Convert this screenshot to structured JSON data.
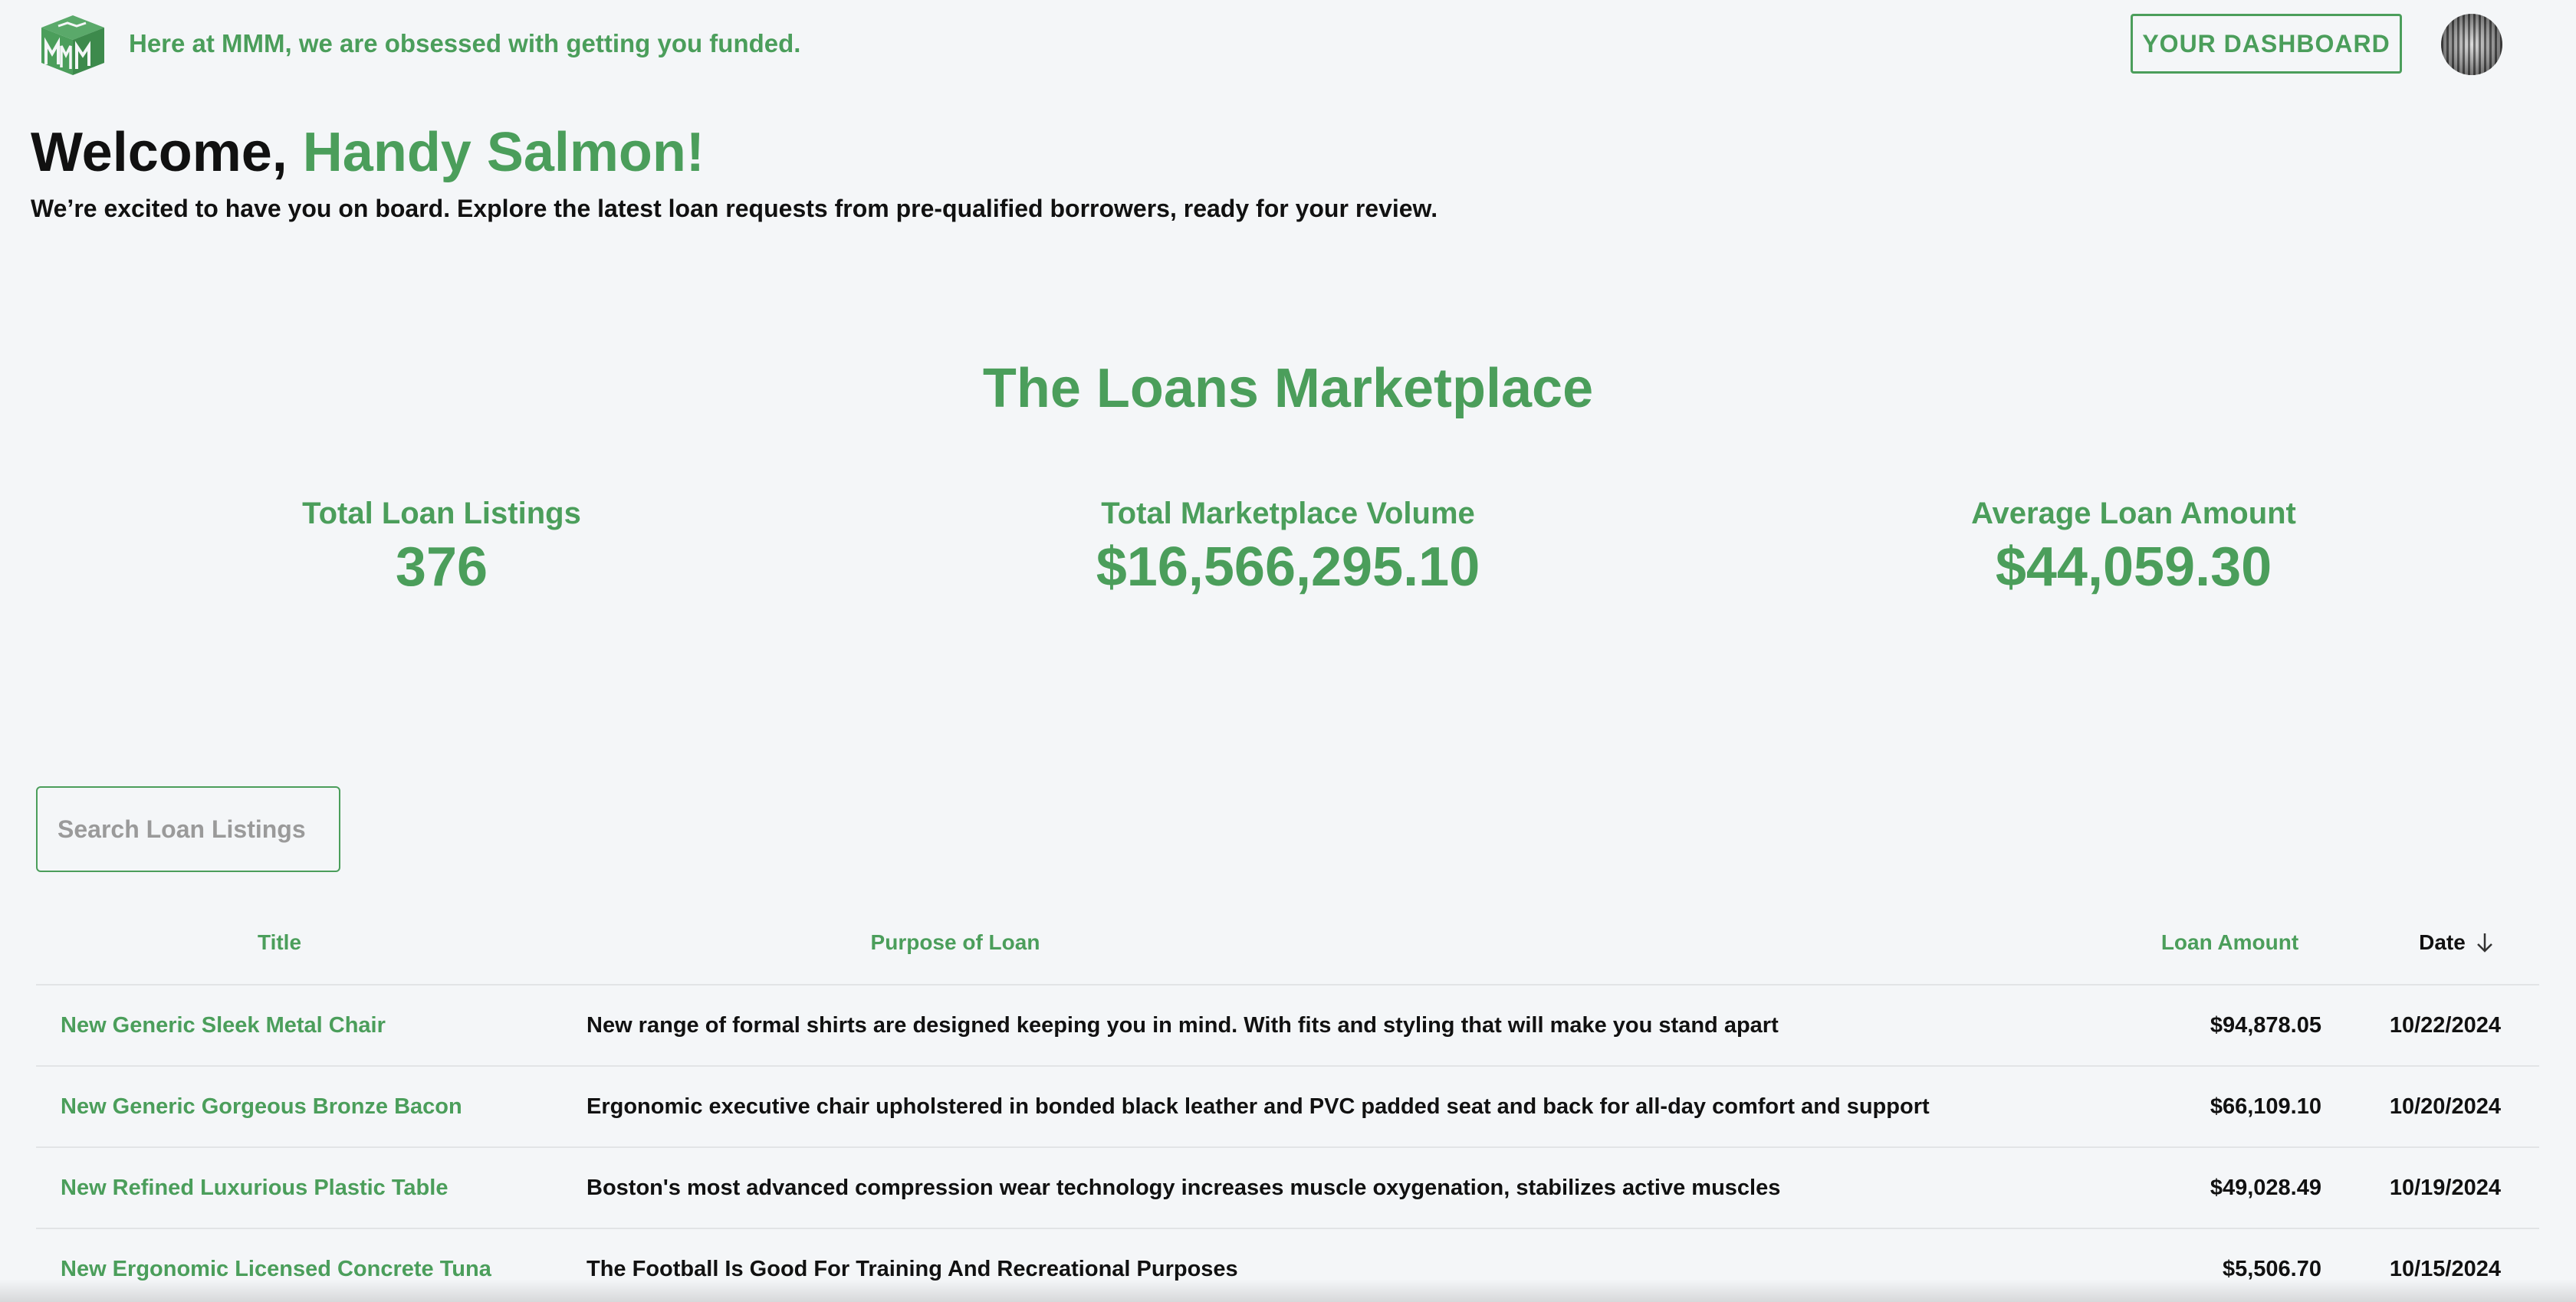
{
  "header": {
    "tagline": "Here at MMM, we are obsessed with getting you funded.",
    "dashboard_button": "YOUR DASHBOARD",
    "logo_icon": "mmm-cube-logo-icon",
    "avatar_icon": "user-avatar"
  },
  "welcome": {
    "prefix": "Welcome, ",
    "name": "Handy Salmon!",
    "subtitle": "We’re excited to have you on board. Explore the latest loan requests from pre-qualified borrowers, ready for your review."
  },
  "marketplace": {
    "title": "The Loans Marketplace",
    "stats": [
      {
        "label": "Total Loan Listings",
        "value": "376"
      },
      {
        "label": "Total Marketplace Volume",
        "value": "$16,566,295.10"
      },
      {
        "label": "Average Loan Amount",
        "value": "$44,059.30"
      }
    ]
  },
  "search": {
    "placeholder": "Search Loan Listings",
    "value": ""
  },
  "table": {
    "columns": {
      "title": "Title",
      "purpose": "Purpose of Loan",
      "amount": "Loan Amount",
      "date": "Date",
      "date_sort_icon": "arrow-down-icon"
    },
    "rows": [
      {
        "title": "New Generic Sleek Metal Chair",
        "purpose": "New range of formal shirts are designed keeping you in mind. With fits and styling that will make you stand apart",
        "amount": "$94,878.05",
        "date": "10/22/2024"
      },
      {
        "title": "New Generic Gorgeous Bronze Bacon",
        "purpose": "Ergonomic executive chair upholstered in bonded black leather and PVC padded seat and back for all-day comfort and support",
        "amount": "$66,109.10",
        "date": "10/20/2024"
      },
      {
        "title": "New Refined Luxurious Plastic Table",
        "purpose": "Boston's most advanced compression wear technology increases muscle oxygenation, stabilizes active muscles",
        "amount": "$49,028.49",
        "date": "10/19/2024"
      },
      {
        "title": "New Ergonomic Licensed Concrete Tuna",
        "purpose": "The Football Is Good For Training And Recreational Purposes",
        "amount": "$5,506.70",
        "date": "10/15/2024"
      }
    ]
  },
  "colors": {
    "brand_green": "#4b9e5b",
    "background": "#f4f6f8",
    "text": "#111111",
    "divider": "#e2e4e6"
  }
}
